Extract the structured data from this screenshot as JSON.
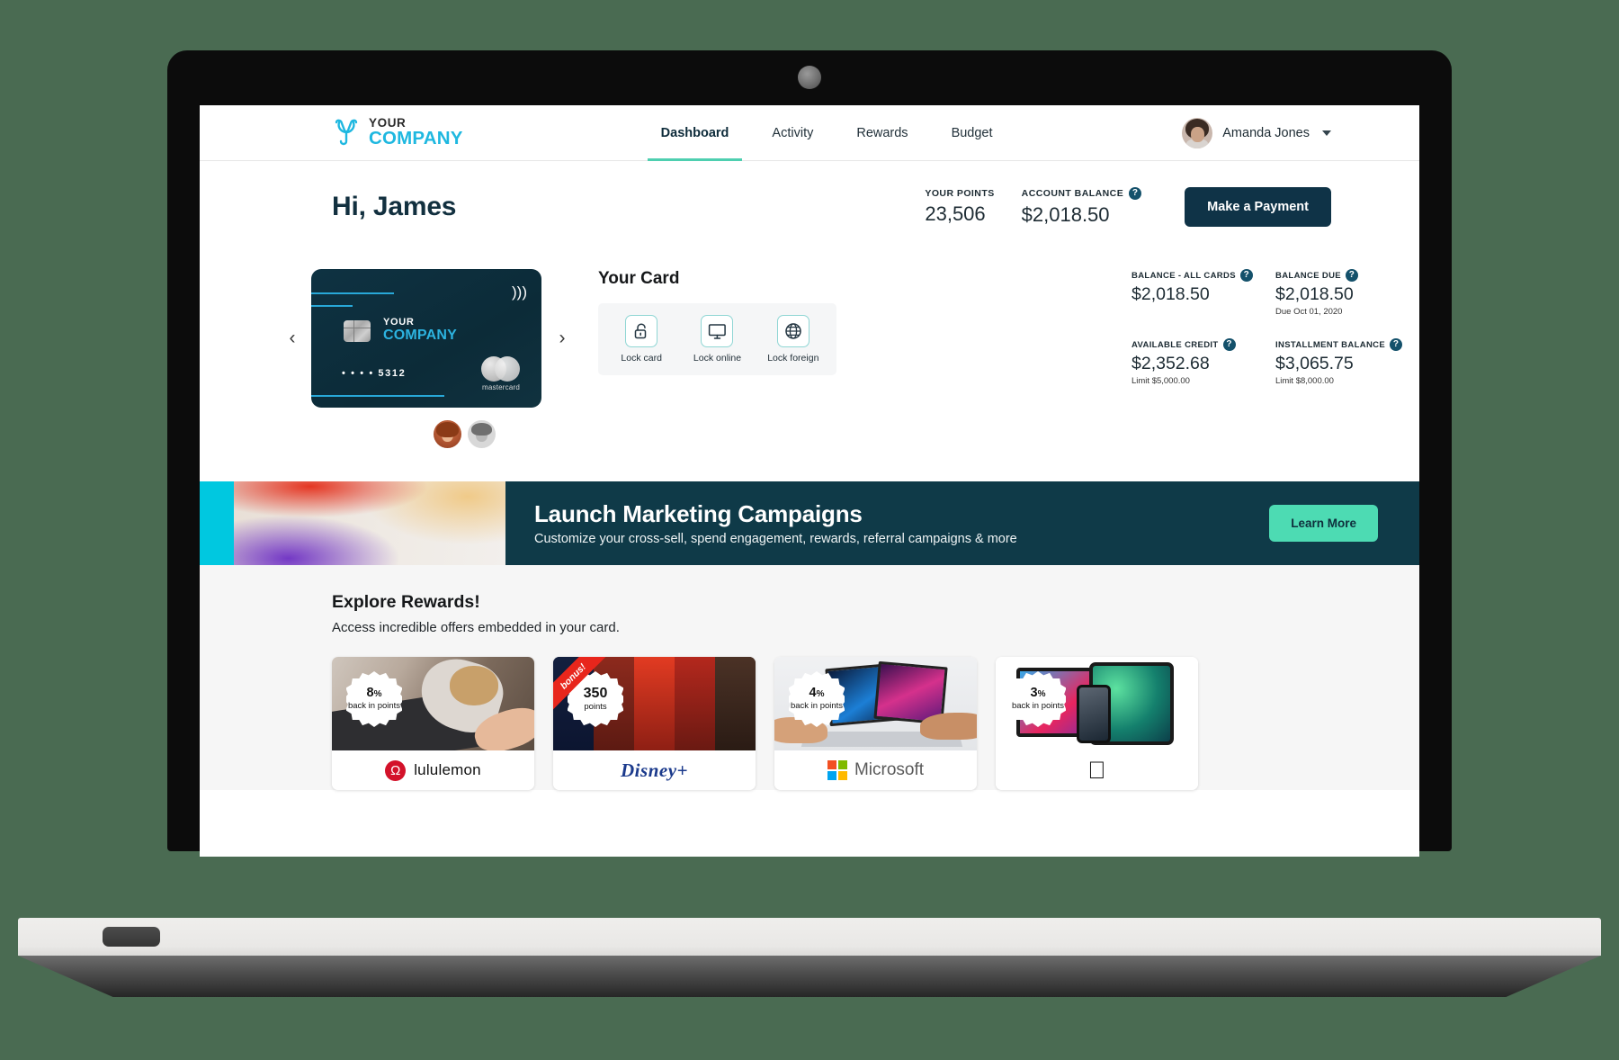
{
  "brand": {
    "line1": "YOUR",
    "line2": "COMPANY",
    "logo_icon": "trefoil-logo-icon",
    "accent": "#1fb8e0"
  },
  "nav": {
    "items": [
      {
        "label": "Dashboard",
        "active": true
      },
      {
        "label": "Activity",
        "active": false
      },
      {
        "label": "Rewards",
        "active": false
      },
      {
        "label": "Budget",
        "active": false
      }
    ],
    "active_underline_color": "#4ecfb0"
  },
  "user": {
    "name": "Amanda Jones",
    "avatar_icon": "user-avatar",
    "caret_icon": "chevron-down-icon"
  },
  "greeting": {
    "text": "Hi, James"
  },
  "summary": {
    "points": {
      "label": "YOUR POINTS",
      "value": "23,506"
    },
    "account_balance": {
      "label": "ACCOUNT BALANCE",
      "value": "$2,018.50",
      "help_icon": "help-circle-icon"
    },
    "pay_button": "Make a Payment"
  },
  "card": {
    "prev_icon": "chevron-left-icon",
    "next_icon": "chevron-right-icon",
    "brand_line1": "YOUR",
    "brand_line2": "COMPANY",
    "number": "• • • •  5312",
    "network": "mastercard",
    "contactless_icon": "contactless-icon",
    "chip_icon": "emv-chip-icon",
    "avatars": [
      "card-holder-avatar-1",
      "card-holder-avatar-2"
    ]
  },
  "your_card": {
    "title": "Your Card",
    "controls": [
      {
        "label": "Lock card",
        "icon": "unlock-icon"
      },
      {
        "label": "Lock online",
        "icon": "monitor-icon"
      },
      {
        "label": "Lock foreign",
        "icon": "globe-icon"
      }
    ]
  },
  "balances": [
    {
      "label": "BALANCE - ALL CARDS",
      "value": "$2,018.50",
      "sub": "",
      "help_icon": "help-circle-icon"
    },
    {
      "label": "BALANCE DUE",
      "value": "$2,018.50",
      "sub": "Due Oct 01, 2020",
      "help_icon": "help-circle-icon"
    },
    {
      "label": "AVAILABLE CREDIT",
      "value": "$2,352.68",
      "sub": "Limit $5,000.00",
      "help_icon": "help-circle-icon"
    },
    {
      "label": "INSTALLMENT BALANCE",
      "value": "$3,065.75",
      "sub": "Limit $8,000.00",
      "help_icon": "help-circle-icon"
    }
  ],
  "promo": {
    "title": "Launch Marketing Campaigns",
    "subtitle": "Customize your cross-sell, spend engagement, rewards, referral campaigns & more",
    "button": "Learn More",
    "bg_color": "#0f3a48",
    "button_color": "#4ddbb3",
    "swatch_color": "#00c8e0"
  },
  "rewards": {
    "title": "Explore Rewards!",
    "subtitle": "Access incredible offers embedded in your card.",
    "cards": [
      {
        "badge_value": "8",
        "badge_unit": "%",
        "badge_sub": "back in points",
        "brand": "lululemon",
        "ribbon": ""
      },
      {
        "badge_value": "350",
        "badge_unit": "",
        "badge_sub": "points",
        "brand": "Disney+",
        "ribbon": "bonus!"
      },
      {
        "badge_value": "4",
        "badge_unit": "%",
        "badge_sub": "back in points",
        "brand": "Microsoft",
        "ribbon": ""
      },
      {
        "badge_value": "3",
        "badge_unit": "%",
        "badge_sub": "back in points",
        "brand": "",
        "ribbon": ""
      }
    ]
  }
}
